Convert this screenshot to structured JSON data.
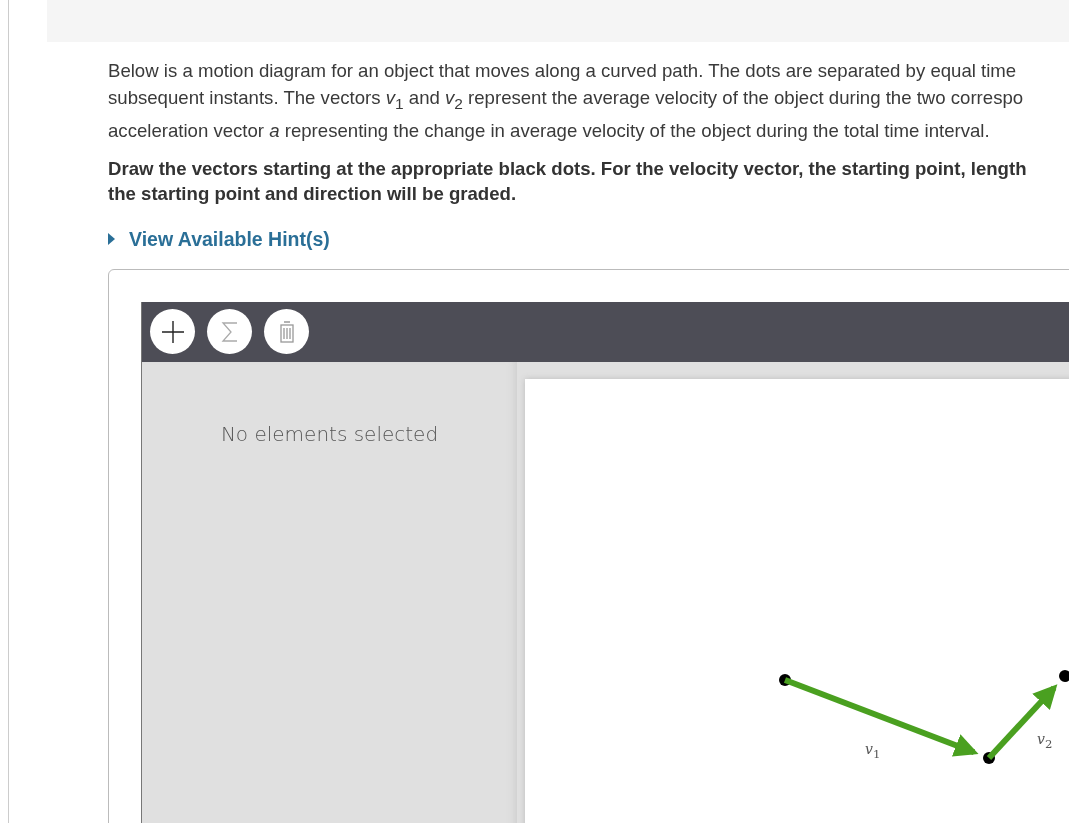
{
  "problem": {
    "intro_lines": [
      "Below is a motion diagram for an object that moves along a curved path. The dots are separated by equal time",
      "subsequent instants. The vectors *v*$_{1}$ and *v*$_{2}$ represent the average velocity of the object during the two correspo",
      "acceleration vector *a* representing the change in average velocity of the object during the total time interval."
    ],
    "instruction_lines": [
      "Draw the vectors starting at the appropriate black dots. For the velocity vector, the starting point, length",
      "the starting point and direction will be graded."
    ],
    "hint_link": {
      "label": "View Available Hint(s)",
      "expanded": false
    }
  },
  "tool": {
    "toolbar": [
      {
        "kind": "add"
      },
      {
        "kind": "sum"
      },
      {
        "kind": "delete"
      }
    ],
    "side_panel": {
      "message": "No elements selected"
    },
    "canvas": {
      "vectors": [
        {
          "label": "*v*$_{1}$"
        },
        {
          "label": "*v*$_{2}$"
        }
      ]
    }
  }
}
